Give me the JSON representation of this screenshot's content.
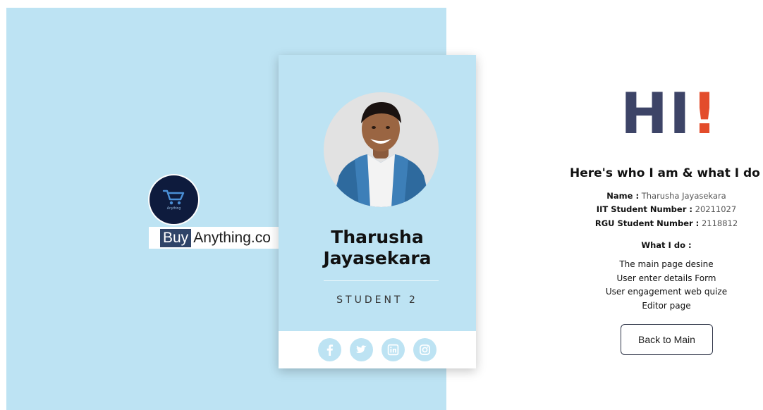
{
  "brand": {
    "logo_text": "Anything",
    "buy": "Buy",
    "rest": "Anything.co"
  },
  "card": {
    "name_line1": "Tharusha",
    "name_line2": "Jayasekara",
    "role": "STUDENT 2",
    "socials": [
      {
        "icon": "facebook-icon"
      },
      {
        "icon": "twitter-icon"
      },
      {
        "icon": "linkedin-icon"
      },
      {
        "icon": "instagram-icon"
      }
    ]
  },
  "intro": {
    "hi_letters": "HI",
    "hi_mark": "!",
    "headline": "Here's who I am & what I do",
    "name_label": "Name :",
    "name_value": "Tharusha Jayasekara",
    "iit_label": "IIT Student Number :",
    "iit_value": "20211027",
    "rgu_label": "RGU Student Number :",
    "rgu_value": "2118812",
    "what_title": "What I do :",
    "what_items": [
      "The main page desine",
      "User enter details Form",
      "User engagement web quize",
      "Editor page"
    ],
    "back_label": "Back to Main"
  },
  "colors": {
    "panel_blue": "#bde3f3",
    "hi_navy": "#3d4467",
    "hi_orange": "#e34c2b"
  }
}
